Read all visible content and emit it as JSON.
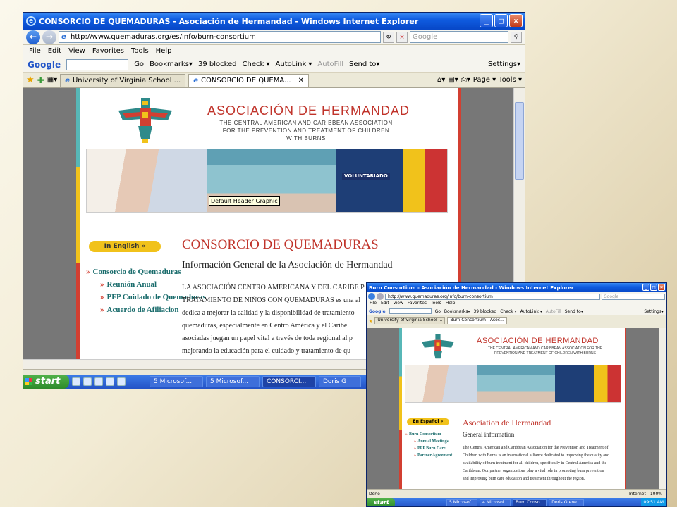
{
  "main_window": {
    "title": "CONSORCIO DE QUEMADURAS - Asociación de Hermandad - Windows Internet Explorer",
    "url": "http://www.quemaduras.org/es/info/burn-consortium",
    "search_placeholder": "Google",
    "menu": [
      "File",
      "Edit",
      "View",
      "Favorites",
      "Tools",
      "Help"
    ],
    "toolbar": {
      "google_label": "Google",
      "go": "Go",
      "bookmarks": "Bookmarks▾",
      "blocked": "39 blocked",
      "check": "Check ▾",
      "autolink": "AutoLink ▾",
      "autofill": "AutoFill",
      "send_to": "Send to▾",
      "settings": "Settings▾"
    },
    "tabs": [
      "University of Virginia School ...",
      "CONSORCIO DE QUEMA..."
    ],
    "right_tools": {
      "page": "Page ▾",
      "tools": "Tools ▾"
    },
    "page": {
      "org_name": "ASOCIACIÓN DE HERMANDAD",
      "org_sub": "THE CENTRAL AMERICAN AND CARIBBEAN ASSOCIATION FOR THE PREVENTION AND TREATMENT OF CHILDREN WITH BURNS",
      "photo_sign": "VOLUNTARIADO",
      "tooltip": "Default Header Graphic",
      "lang_button": "In English »",
      "nav": [
        {
          "label": "Consorcio de Quemaduras",
          "sub": false
        },
        {
          "label": "Reunión Anual",
          "sub": true
        },
        {
          "label": "PFP Cuidado de Quemaduras",
          "sub": true
        },
        {
          "label": "Acuerdo de Afiliacion",
          "sub": true
        }
      ],
      "title": "CONSORCIO DE QUEMADURAS",
      "subtitle": "Información General de la Asociación de Hermandad",
      "body_lines": [
        "LA ASOCIACIÓN CENTRO AMERICANA Y DEL CARIBE P",
        "TRATAMIENTO DE NIÑOS CON QUEMADURAS es una al",
        "dedica a mejorar la calidad y la disponibilidad de tratamiento",
        "quemaduras, especialmente en Centro América y el Caribe.",
        "asociadas juegan un papel vital a través de toda regional al p",
        "mejorando la educación para el cuidado y tratamiento de qu"
      ]
    }
  },
  "taskbar": {
    "start": "start",
    "buttons": [
      "5 Microsof...",
      "5 Microsof...",
      "CONSORCI...",
      "Doris G"
    ]
  },
  "second_window": {
    "title": "Burn Consortium - Asociación de Hermandad - Windows Internet Explorer",
    "url": "http://www.quemaduras.org/info/burn-consortium",
    "search_placeholder": "Google",
    "menu": [
      "File",
      "Edit",
      "View",
      "Favorites",
      "Tools",
      "Help"
    ],
    "toolbar_items": [
      "Google",
      "Go",
      "Bookmarks▾",
      "39 blocked",
      "Check ▾",
      "AutoLink ▾",
      "AutoFill",
      "Send to▾",
      "Settings▾"
    ],
    "tabs": [
      "University of Virginia School ...",
      "Burn Consortium - Asoc..."
    ],
    "page": {
      "org_name": "ASOCIACIÓN DE HERMANDAD",
      "org_sub": "THE CENTRAL AMERICAN AND CARIBBEAN ASSOCIATION FOR THE PREVENTION AND TREATMENT OF CHILDREN WITH BURNS",
      "lang_button": "En Español »",
      "nav": [
        {
          "label": "Burn Consortium",
          "sub": false
        },
        {
          "label": "Annual Meetings",
          "sub": true
        },
        {
          "label": "PFP Burn Care",
          "sub": true
        },
        {
          "label": "Partner Agreement",
          "sub": true
        }
      ],
      "title": "Asociation de Hermandad",
      "subtitle": "General information",
      "body_lines": [
        "The Central American and Caribbean Association for the Prevention and Treatment of",
        "Children with Burns is an international alliance dedicated to improving the quality and",
        "availability of burn treatment for all children, specifically in Central America and the",
        "Caribbean. Our partner organizations play a vital role in promoting burn prevention",
        "and improving burn care education and treatment throughout the region."
      ]
    },
    "status_done": "Done",
    "status_zone": "Internet",
    "zoom": "100%",
    "taskbar": {
      "start": "start",
      "buttons": [
        "5 Microsof...",
        "4 Microsof...",
        "Burn Conso...",
        "Doris Grene..."
      ],
      "clock": "09:51 AM"
    }
  }
}
